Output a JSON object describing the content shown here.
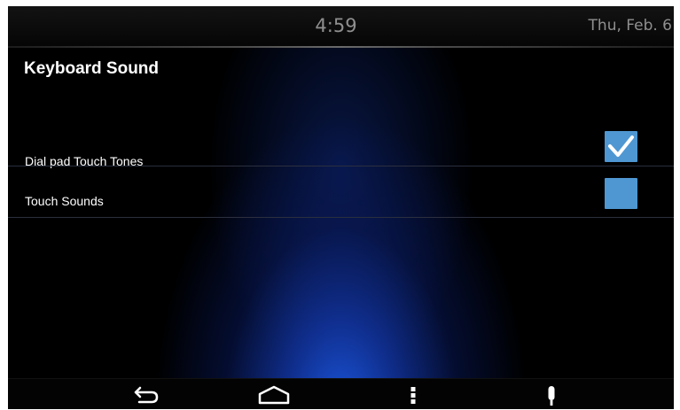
{
  "status_bar": {
    "time": "4:59",
    "date": "Thu, Feb. 6"
  },
  "page": {
    "title": "Keyboard Sound"
  },
  "settings": [
    {
      "label": "Dial pad Touch Tones",
      "checked": true
    },
    {
      "label": "Touch Sounds",
      "checked": false
    }
  ],
  "nav_bar": {
    "icons": [
      "back-arrow-icon",
      "home-icon",
      "menu-icon",
      "microphone-icon"
    ]
  },
  "colors": {
    "checkbox": "#4f97d2",
    "accent_glow": "#1c5ae6",
    "text": "#ffffff",
    "status_text": "#8f8f8f"
  }
}
